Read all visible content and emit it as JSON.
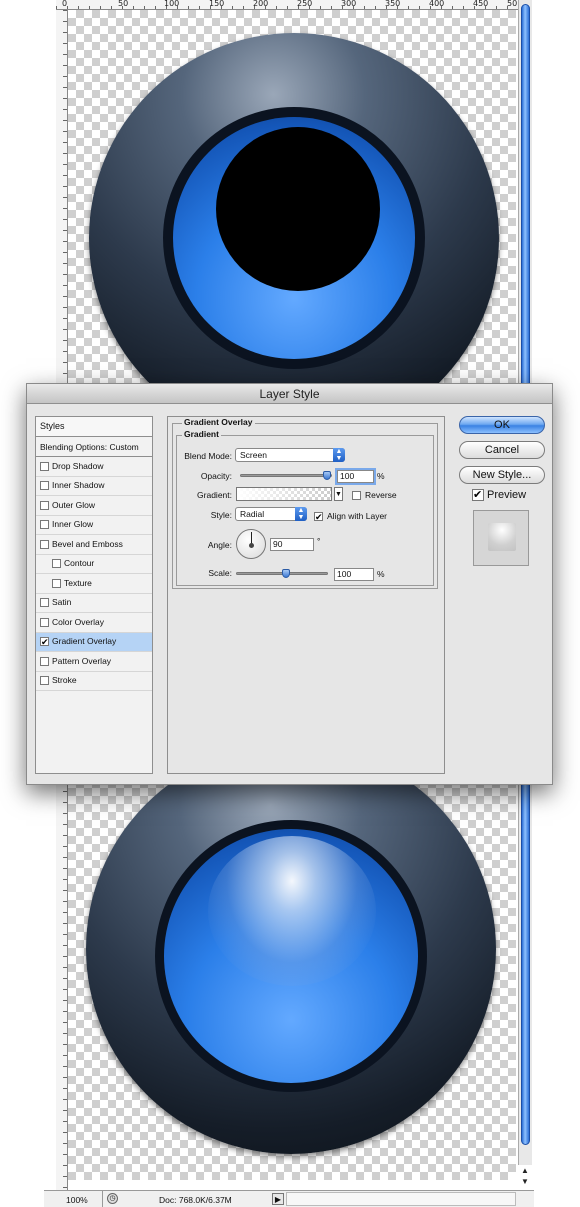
{
  "ruler_top_labels": [
    "0",
    "50",
    "100",
    "150",
    "200",
    "250",
    "300",
    "350",
    "400",
    "450",
    "50"
  ],
  "dialog": {
    "title": "Layer Style",
    "styles_header": "Styles",
    "blending_options": "Blending Options: Custom",
    "style_items": [
      {
        "label": "Drop Shadow",
        "checked": false
      },
      {
        "label": "Inner Shadow",
        "checked": false
      },
      {
        "label": "Outer Glow",
        "checked": false
      },
      {
        "label": "Inner Glow",
        "checked": false
      },
      {
        "label": "Bevel and Emboss",
        "checked": false
      },
      {
        "label": "Contour",
        "checked": false
      },
      {
        "label": "Texture",
        "checked": false
      },
      {
        "label": "Satin",
        "checked": false
      },
      {
        "label": "Color Overlay",
        "checked": false
      },
      {
        "label": "Gradient Overlay",
        "checked": true
      },
      {
        "label": "Pattern Overlay",
        "checked": false
      },
      {
        "label": "Stroke",
        "checked": false
      }
    ],
    "section_title": "Gradient Overlay",
    "group_title": "Gradient",
    "blend_mode_label": "Blend Mode:",
    "blend_mode_value": "Screen",
    "opacity_label": "Opacity:",
    "opacity_value": "100",
    "opacity_unit": "%",
    "opacity_level": 1.0,
    "gradient_label": "Gradient:",
    "reverse_label": "Reverse",
    "reverse_checked": false,
    "style_label": "Style:",
    "style_value": "Radial",
    "align_label": "Align with Layer",
    "align_checked": true,
    "angle_label": "Angle:",
    "angle_value": "90",
    "angle_unit": "°",
    "scale_label": "Scale:",
    "scale_value": "100",
    "scale_unit": "%",
    "scale_level": 0.55,
    "ok_label": "OK",
    "cancel_label": "Cancel",
    "new_style_label": "New Style...",
    "preview_label": "Preview",
    "preview_checked": true
  },
  "statusbar": {
    "zoom": "100%",
    "doc": "Doc: 768.0K/6.37M"
  },
  "colors": {
    "accent_blue": "#2b7fe9",
    "selection": "#b5d3f5",
    "button_blue": "#3a82e3"
  }
}
